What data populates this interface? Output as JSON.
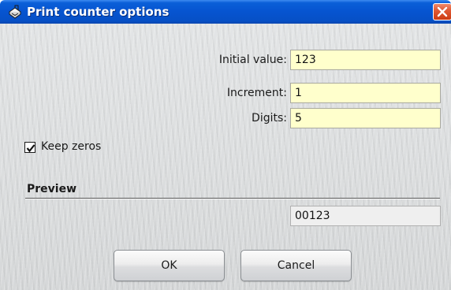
{
  "window": {
    "title": "Print counter options",
    "title_bar_color": "#0654d0",
    "close_button_color": "#e05a35"
  },
  "form": {
    "initial_value": {
      "label": "Initial value:",
      "value": "123"
    },
    "increment": {
      "label": "Increment:",
      "value": "1"
    },
    "digits": {
      "label": "Digits:",
      "value": "5"
    },
    "field_background": "#ffffcc"
  },
  "keep_zeros": {
    "label": "Keep zeros",
    "checked": true
  },
  "preview": {
    "title": "Preview",
    "value": "00123"
  },
  "buttons": {
    "ok": "OK",
    "cancel": "Cancel"
  },
  "icons": {
    "title": "printer-counter-icon",
    "close": "close-icon",
    "check": "checkmark-icon"
  }
}
